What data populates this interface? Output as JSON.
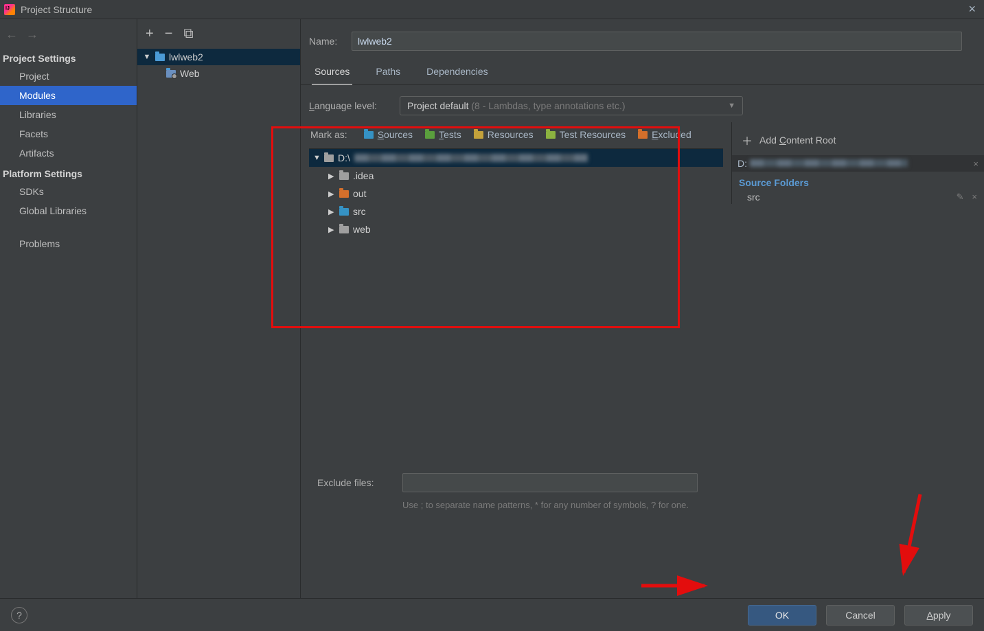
{
  "window": {
    "title": "Project Structure"
  },
  "nav": {
    "back_arrow": "←",
    "fwd_arrow": "→",
    "section_project": "Project Settings",
    "section_platform": "Platform Settings",
    "items_project": [
      {
        "label": "Project"
      },
      {
        "label": "Modules",
        "selected": true
      },
      {
        "label": "Libraries"
      },
      {
        "label": "Facets"
      },
      {
        "label": "Artifacts"
      }
    ],
    "items_platform": [
      {
        "label": "SDKs"
      },
      {
        "label": "Global Libraries"
      }
    ],
    "problems": "Problems"
  },
  "midtree": {
    "toolbar": {
      "add": "+",
      "remove": "−",
      "copy": "⧉"
    },
    "module": "lwlweb2",
    "facet": "Web"
  },
  "form": {
    "name_label": "Name:",
    "name_value": "lwlweb2",
    "tabs": [
      {
        "label": "Sources",
        "active": true
      },
      {
        "label": "Paths"
      },
      {
        "label": "Dependencies"
      }
    ],
    "lang_label_text": "Language level:",
    "lang_label_prefix": "L",
    "lang_label_rest": "anguage level:",
    "lang_value_main": "Project default",
    "lang_value_hint": "(8 - Lambdas, type annotations etc.)"
  },
  "markas": {
    "label": "Mark as:",
    "sources_u": "S",
    "sources_rest": "ources",
    "tests_u": "T",
    "tests_rest": "ests",
    "resources": "Resources",
    "testres": "Test Resources",
    "excluded_u": "E",
    "excluded_rest": "xcluded"
  },
  "filetree": {
    "root": "D:\\",
    "children": [
      {
        "label": ".idea",
        "color": "grey"
      },
      {
        "label": "out",
        "color": "orange"
      },
      {
        "label": "src",
        "color": "blue"
      },
      {
        "label": "web",
        "color": "grey"
      }
    ]
  },
  "rightpanel": {
    "add_root_text": "Add ",
    "add_root_u": "C",
    "add_root_rest": "ontent Root",
    "root_prefix": "D:",
    "source_folders_title": "Source Folders",
    "source_item": "src"
  },
  "exclude": {
    "label": "Exclude files:",
    "value": "",
    "hint": "Use ; to separate name patterns, * for any number of symbols, ? for one."
  },
  "footer": {
    "help": "?",
    "ok": "OK",
    "cancel": "Cancel",
    "apply_u": "A",
    "apply_rest": "pply"
  }
}
